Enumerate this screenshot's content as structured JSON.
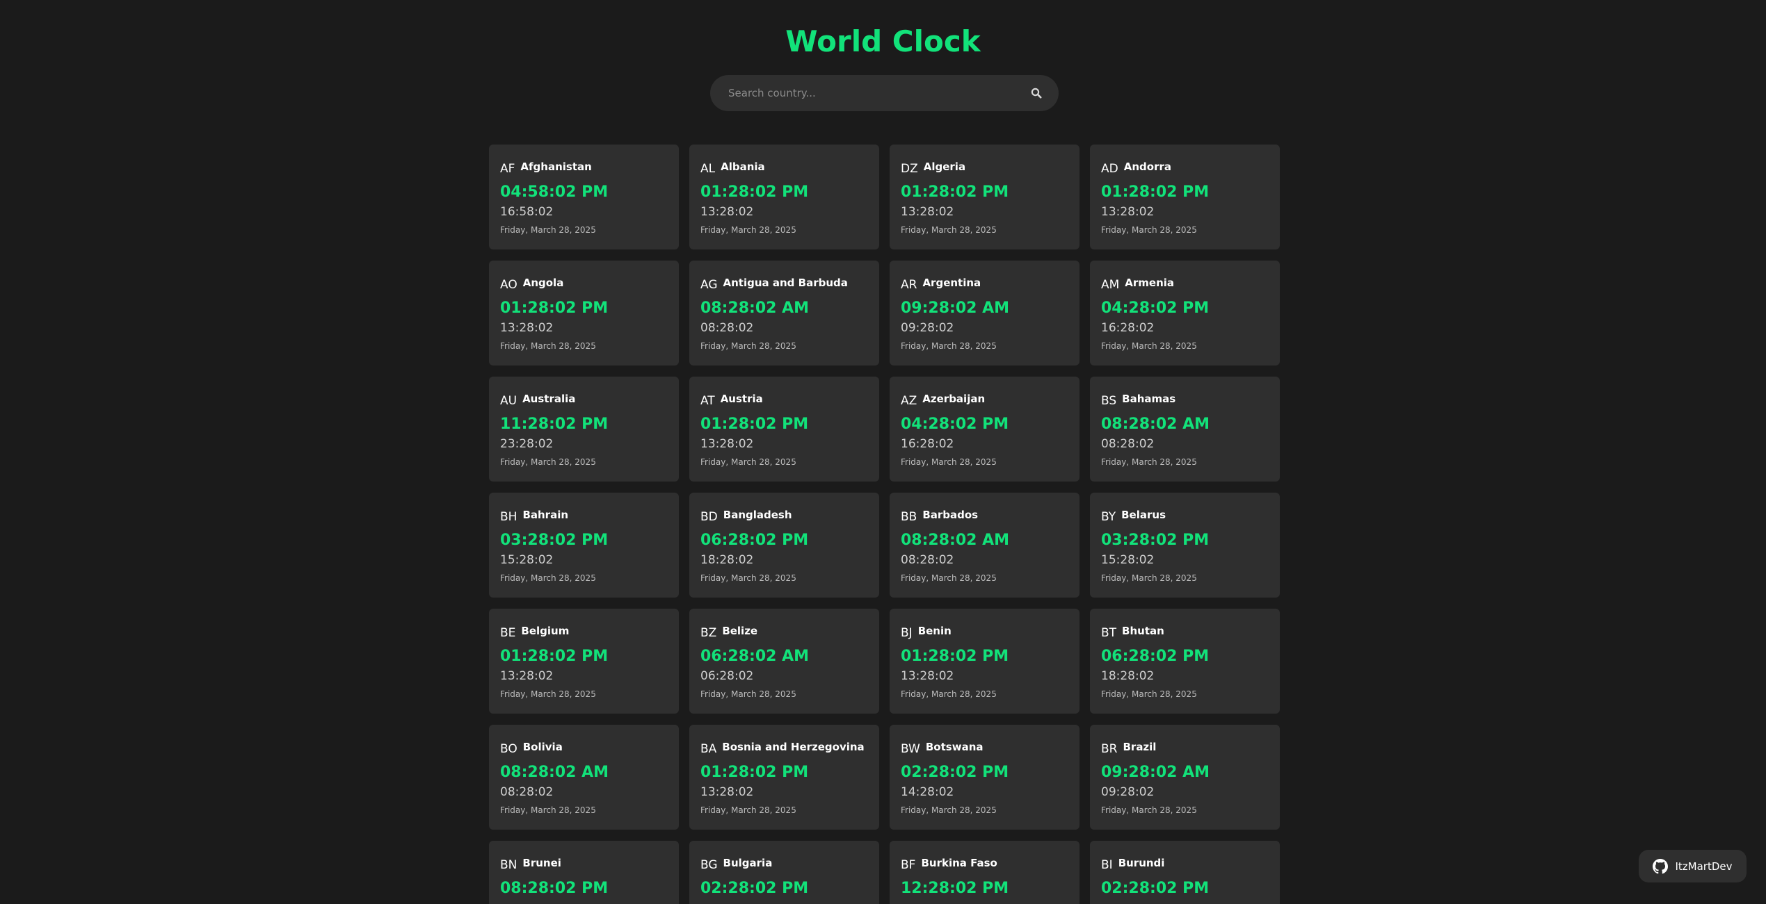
{
  "header": {
    "title": "World Clock"
  },
  "search": {
    "placeholder": "Search country..."
  },
  "colors": {
    "background": "#1b1b1b",
    "card": "#2f2f2f",
    "accent": "#12e27a"
  },
  "countries": [
    {
      "code": "AF",
      "name": "Afghanistan",
      "time12": "04:58:02 PM",
      "time24": "16:58:02",
      "date": "Friday, March 28, 2025"
    },
    {
      "code": "AL",
      "name": "Albania",
      "time12": "01:28:02 PM",
      "time24": "13:28:02",
      "date": "Friday, March 28, 2025"
    },
    {
      "code": "DZ",
      "name": "Algeria",
      "time12": "01:28:02 PM",
      "time24": "13:28:02",
      "date": "Friday, March 28, 2025"
    },
    {
      "code": "AD",
      "name": "Andorra",
      "time12": "01:28:02 PM",
      "time24": "13:28:02",
      "date": "Friday, March 28, 2025"
    },
    {
      "code": "AO",
      "name": "Angola",
      "time12": "01:28:02 PM",
      "time24": "13:28:02",
      "date": "Friday, March 28, 2025"
    },
    {
      "code": "AG",
      "name": "Antigua and Barbuda",
      "time12": "08:28:02 AM",
      "time24": "08:28:02",
      "date": "Friday, March 28, 2025"
    },
    {
      "code": "AR",
      "name": "Argentina",
      "time12": "09:28:02 AM",
      "time24": "09:28:02",
      "date": "Friday, March 28, 2025"
    },
    {
      "code": "AM",
      "name": "Armenia",
      "time12": "04:28:02 PM",
      "time24": "16:28:02",
      "date": "Friday, March 28, 2025"
    },
    {
      "code": "AU",
      "name": "Australia",
      "time12": "11:28:02 PM",
      "time24": "23:28:02",
      "date": "Friday, March 28, 2025"
    },
    {
      "code": "AT",
      "name": "Austria",
      "time12": "01:28:02 PM",
      "time24": "13:28:02",
      "date": "Friday, March 28, 2025"
    },
    {
      "code": "AZ",
      "name": "Azerbaijan",
      "time12": "04:28:02 PM",
      "time24": "16:28:02",
      "date": "Friday, March 28, 2025"
    },
    {
      "code": "BS",
      "name": "Bahamas",
      "time12": "08:28:02 AM",
      "time24": "08:28:02",
      "date": "Friday, March 28, 2025"
    },
    {
      "code": "BH",
      "name": "Bahrain",
      "time12": "03:28:02 PM",
      "time24": "15:28:02",
      "date": "Friday, March 28, 2025"
    },
    {
      "code": "BD",
      "name": "Bangladesh",
      "time12": "06:28:02 PM",
      "time24": "18:28:02",
      "date": "Friday, March 28, 2025"
    },
    {
      "code": "BB",
      "name": "Barbados",
      "time12": "08:28:02 AM",
      "time24": "08:28:02",
      "date": "Friday, March 28, 2025"
    },
    {
      "code": "BY",
      "name": "Belarus",
      "time12": "03:28:02 PM",
      "time24": "15:28:02",
      "date": "Friday, March 28, 2025"
    },
    {
      "code": "BE",
      "name": "Belgium",
      "time12": "01:28:02 PM",
      "time24": "13:28:02",
      "date": "Friday, March 28, 2025"
    },
    {
      "code": "BZ",
      "name": "Belize",
      "time12": "06:28:02 AM",
      "time24": "06:28:02",
      "date": "Friday, March 28, 2025"
    },
    {
      "code": "BJ",
      "name": "Benin",
      "time12": "01:28:02 PM",
      "time24": "13:28:02",
      "date": "Friday, March 28, 2025"
    },
    {
      "code": "BT",
      "name": "Bhutan",
      "time12": "06:28:02 PM",
      "time24": "18:28:02",
      "date": "Friday, March 28, 2025"
    },
    {
      "code": "BO",
      "name": "Bolivia",
      "time12": "08:28:02 AM",
      "time24": "08:28:02",
      "date": "Friday, March 28, 2025"
    },
    {
      "code": "BA",
      "name": "Bosnia and Herzegovina",
      "time12": "01:28:02 PM",
      "time24": "13:28:02",
      "date": "Friday, March 28, 2025"
    },
    {
      "code": "BW",
      "name": "Botswana",
      "time12": "02:28:02 PM",
      "time24": "14:28:02",
      "date": "Friday, March 28, 2025"
    },
    {
      "code": "BR",
      "name": "Brazil",
      "time12": "09:28:02 AM",
      "time24": "09:28:02",
      "date": "Friday, March 28, 2025"
    },
    {
      "code": "BN",
      "name": "Brunei",
      "time12": "08:28:02 PM"
    },
    {
      "code": "BG",
      "name": "Bulgaria",
      "time12": "02:28:02 PM"
    },
    {
      "code": "BF",
      "name": "Burkina Faso",
      "time12": "12:28:02 PM"
    },
    {
      "code": "BI",
      "name": "Burundi",
      "time12": "02:28:02 PM"
    }
  ],
  "github": {
    "label": "ItzMartDev",
    "icon": "github-icon"
  }
}
